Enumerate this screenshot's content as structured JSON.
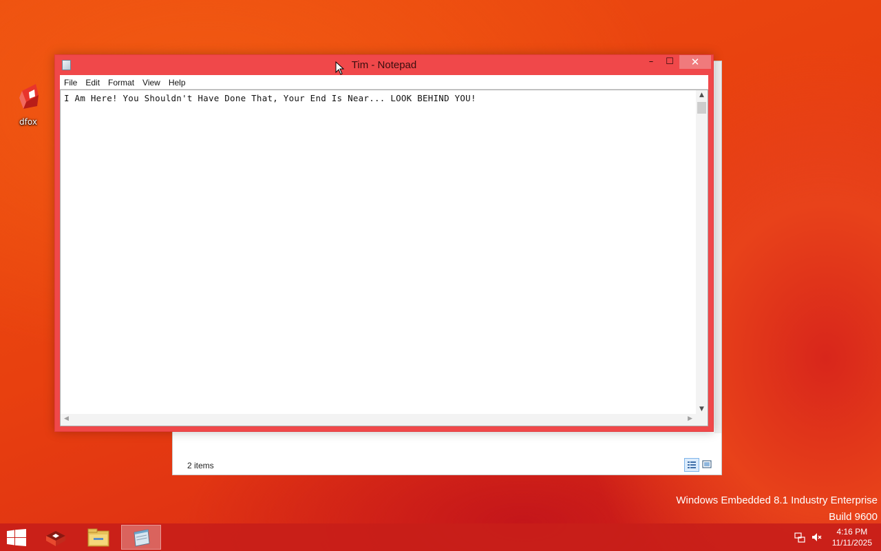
{
  "desktop": {
    "icons": [
      {
        "label": "dfox",
        "icon": "redfox-browser-icon"
      }
    ]
  },
  "explorer": {
    "status_count": "2 items",
    "view_buttons": [
      "details-view-icon",
      "large-icons-view-icon"
    ]
  },
  "notepad": {
    "title": "Tim - Notepad",
    "buttons": {
      "minimize": "–",
      "maximize": "☐",
      "close": "✕"
    },
    "menu": [
      "File",
      "Edit",
      "Format",
      "View",
      "Help"
    ],
    "content": "I Am Here! You Shouldn't Have Done That, Your End Is Near... LOOK BEHIND YOU!"
  },
  "watermark": {
    "line1": "Windows Embedded 8.1 Industry Enterprise",
    "line2": "Build 9600"
  },
  "taskbar": {
    "apps": [
      "redfox-icon",
      "file-explorer-icon",
      "notepad-icon"
    ],
    "active_app": "notepad-icon",
    "tray": [
      "network-icon",
      "volume-muted-icon"
    ],
    "clock": {
      "time": "4:16 PM",
      "date": "11/11/2025"
    }
  },
  "colors": {
    "accent": "#f0484a",
    "taskbar": "#c81e19",
    "desktop": "#e8400f"
  }
}
